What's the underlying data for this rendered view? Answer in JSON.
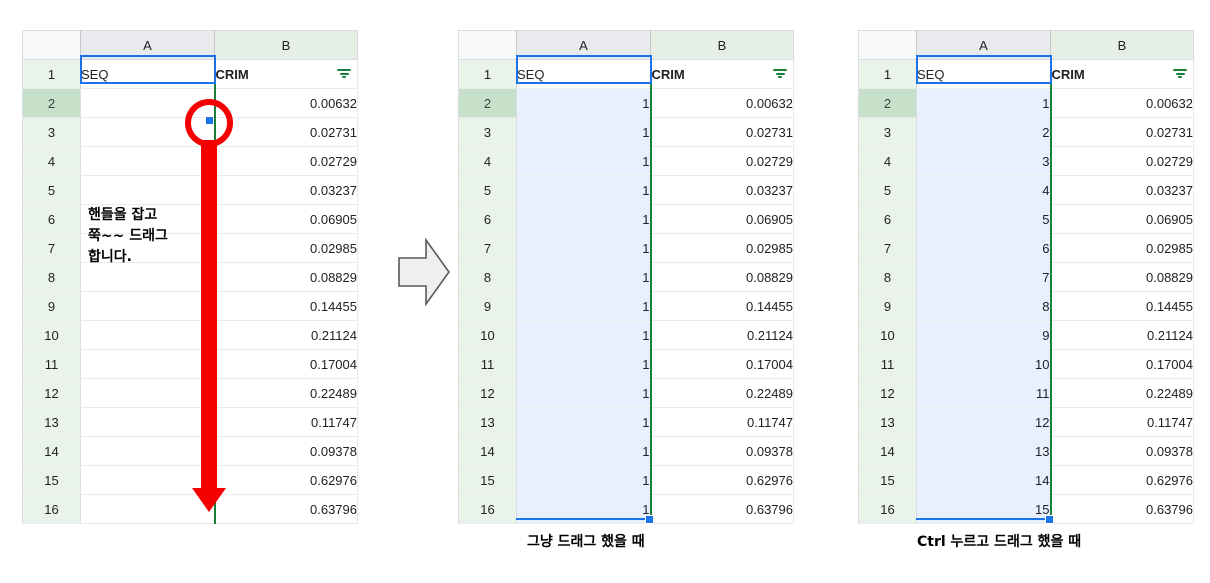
{
  "columns": {
    "a": "A",
    "b": "B"
  },
  "headers": {
    "seq": "SEQ",
    "crim": "CRIM"
  },
  "row_numbers": [
    "1",
    "2",
    "3",
    "4",
    "5",
    "6",
    "7",
    "8",
    "9",
    "10",
    "11",
    "12",
    "13",
    "14",
    "15",
    "16"
  ],
  "crim_values": [
    "0.00632",
    "0.02731",
    "0.02729",
    "0.03237",
    "0.06905",
    "0.02985",
    "0.08829",
    "0.14455",
    "0.21124",
    "0.17004",
    "0.22489",
    "0.11747",
    "0.09378",
    "0.62976",
    "0.63796"
  ],
  "panel1": {
    "seq_values": [
      "",
      "",
      "",
      "",
      "",
      "",
      "",
      "",
      "",
      "",
      "",
      "",
      "",
      "",
      ""
    ],
    "active_cell": "A2",
    "annotation": "핸들을 잡고\n쭉~~ 드래그\n합니다."
  },
  "panel2": {
    "seq_values": [
      "1",
      "1",
      "1",
      "1",
      "1",
      "1",
      "1",
      "1",
      "1",
      "1",
      "1",
      "1",
      "1",
      "1",
      "1"
    ],
    "active_cell": "A2",
    "caption": "그냥 드래그 했을 때"
  },
  "panel3": {
    "seq_values": [
      "1",
      "2",
      "3",
      "4",
      "5",
      "6",
      "7",
      "8",
      "9",
      "10",
      "11",
      "12",
      "13",
      "14",
      "15"
    ],
    "active_cell": "A2",
    "caption": "Ctrl 누르고 드래그 했을 때"
  },
  "icons": {
    "filter": "filter-funnel-icon",
    "flow_arrow": "right-block-arrow-icon",
    "drag_arrow": "red-down-arrow-icon",
    "highlight": "red-circle-highlight"
  },
  "colors": {
    "selection_fill": "#e8f0fe",
    "selection_border": "#1a73e8",
    "row_header": "#e9f3ea",
    "col_header_b": "#e6efe6",
    "accent_green": "#188038",
    "annotation_red": "#f50000"
  }
}
